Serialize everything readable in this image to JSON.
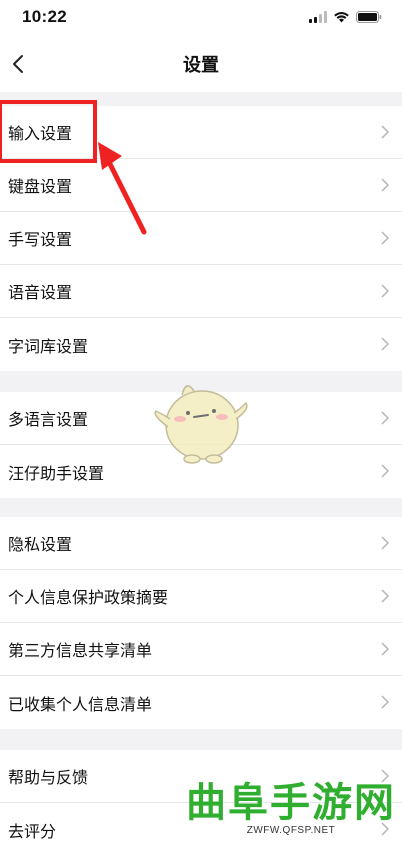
{
  "status_bar": {
    "time": "10:22",
    "icons": [
      "signal-icon",
      "wifi-icon",
      "battery-icon"
    ]
  },
  "nav": {
    "back_icon": "chevron-left-icon",
    "title": "设置"
  },
  "groups": [
    {
      "items": [
        {
          "label": "输入设置"
        },
        {
          "label": "键盘设置"
        },
        {
          "label": "手写设置"
        },
        {
          "label": "语音设置"
        },
        {
          "label": "字词库设置"
        }
      ]
    },
    {
      "items": [
        {
          "label": "多语言设置"
        },
        {
          "label": "汪仔助手设置"
        }
      ]
    },
    {
      "items": [
        {
          "label": "隐私设置"
        },
        {
          "label": "个人信息保护政策摘要"
        },
        {
          "label": "第三方信息共享清单"
        },
        {
          "label": "已收集个人信息清单"
        }
      ]
    },
    {
      "items": [
        {
          "label": "帮助与反馈"
        },
        {
          "label": "去评分"
        }
      ]
    }
  ],
  "annotation": {
    "color": "#ee2222"
  },
  "watermark": {
    "title": "曲阜手游网",
    "url": "ZWFW.QFSP.NET",
    "color": "#2fae2f"
  },
  "colors": {
    "background": "#f2f2f4",
    "divider": "#e6e6e8",
    "arrow": "#b5b5b8"
  }
}
